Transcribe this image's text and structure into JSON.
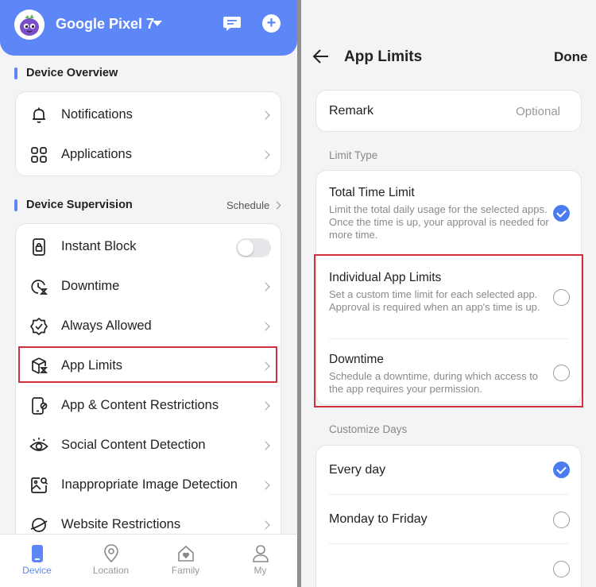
{
  "left": {
    "device_name": "Google Pixel 7",
    "accent": "#5d87f6",
    "section_overview": "Device Overview",
    "overview_items": [
      {
        "label": "Notifications",
        "icon": "bell-icon"
      },
      {
        "label": "Applications",
        "icon": "grid-icon"
      }
    ],
    "section_supervision": "Device Supervision",
    "schedule_link": "Schedule",
    "supervision_items": [
      {
        "label": "Instant Block",
        "icon": "lock-phone-icon",
        "toggle": false
      },
      {
        "label": "Downtime",
        "icon": "clock-hourglass-icon"
      },
      {
        "label": "Always Allowed",
        "icon": "badge-check-icon"
      },
      {
        "label": "App Limits",
        "icon": "box-hourglass-icon",
        "highlighted": true
      },
      {
        "label": "App & Content Restrictions",
        "icon": "phone-restrict-icon"
      },
      {
        "label": "Social Content Detection",
        "icon": "eye-icon"
      },
      {
        "label": "Inappropriate Image Detection",
        "icon": "image-search-icon"
      },
      {
        "label": "Website Restrictions",
        "icon": "planet-icon"
      }
    ],
    "nav": [
      {
        "label": "Device",
        "icon": "phone-icon",
        "active": true
      },
      {
        "label": "Location",
        "icon": "location-pin-icon",
        "active": false
      },
      {
        "label": "Family",
        "icon": "home-heart-icon",
        "active": false
      },
      {
        "label": "My",
        "icon": "person-icon",
        "active": false
      }
    ]
  },
  "right": {
    "title": "App Limits",
    "done_label": "Done",
    "remark_label": "Remark",
    "remark_placeholder": "Optional",
    "limit_type_label": "Limit Type",
    "limit_types": [
      {
        "title": "Total Time Limit",
        "desc": "Limit the total daily usage for the selected apps. Once the time is up, your approval is needed for more time.",
        "checked": true
      },
      {
        "title": "Individual App Limits",
        "desc": "Set a custom time limit for each selected app. Approval is required when an app's time is up.",
        "checked": false
      },
      {
        "title": "Downtime",
        "desc": "Schedule a downtime, during which access to the app requires your permission.",
        "checked": false
      }
    ],
    "customize_days_label": "Customize Days",
    "days": [
      {
        "label": "Every day",
        "checked": true
      },
      {
        "label": "Monday to Friday",
        "checked": false
      },
      {
        "label": "",
        "checked": false
      }
    ],
    "check_color": "#4a7cf0",
    "highlight_color": "#d2303a"
  }
}
